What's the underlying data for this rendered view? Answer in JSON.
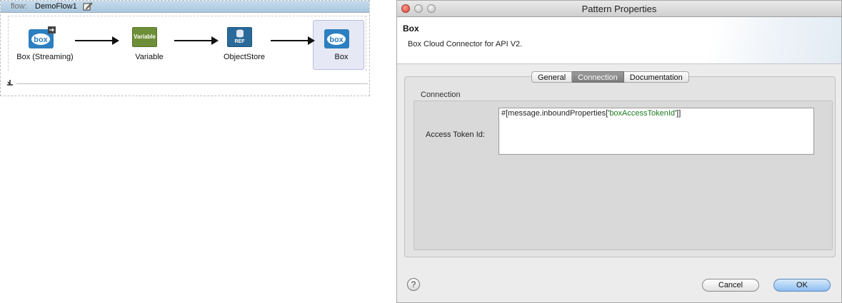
{
  "flow": {
    "keyword": "flow:",
    "name": "DemoFlow1",
    "nodes": [
      {
        "label": "Box (Streaming)",
        "icon": "box-streaming-icon"
      },
      {
        "label": "Variable",
        "icon_text": "Variable"
      },
      {
        "label": "ObjectStore",
        "icon_text": "REF"
      },
      {
        "label": "Box",
        "icon": "box-icon"
      }
    ],
    "box_logo_text": "box"
  },
  "dialog": {
    "title": "Pattern Properties",
    "header_title": "Box",
    "header_desc": "Box Cloud Connector for API V2.",
    "tabs": [
      {
        "label": "General",
        "active": false
      },
      {
        "label": "Connection",
        "active": true
      },
      {
        "label": "Documentation",
        "active": false
      }
    ],
    "group_label": "Connection",
    "field_label": "Access Token Id:",
    "field_value_prefix": "#[message.inboundProperties['",
    "field_value_string": "boxAccessTokenId",
    "field_value_suffix": "']]",
    "help": "?",
    "cancel": "Cancel",
    "ok": "OK"
  },
  "colors": {
    "flow_header": "#b5cfe3",
    "variable_icon": "#6e8f3a",
    "objectstore_icon": "#2a6a9a",
    "box_icon": "#2c7fc0",
    "selected_node": "#e6e8f5",
    "ok_button": "#8ebef0",
    "string_literal": "#1f7a1f"
  }
}
